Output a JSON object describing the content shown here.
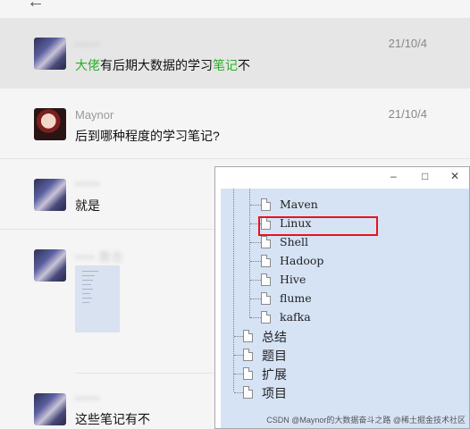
{
  "messages": [
    {
      "name": "•••••",
      "date": "21/10/4",
      "text_parts": [
        "大佬",
        "有后期大数据的学习",
        "笔记",
        "不"
      ]
    },
    {
      "name": "Maynor",
      "date": "21/10/4",
      "text": "后到哪种程度的学习笔记?"
    },
    {
      "name": "•••••",
      "text": "就是"
    },
    {
      "name": "•••• 数仓",
      "text": ""
    },
    {
      "name": "•••••",
      "text": "这些笔记有不"
    }
  ],
  "window": {
    "minimize": "–",
    "maximize": "□",
    "close": "✕"
  },
  "tree": {
    "files": [
      "Maven",
      "Linux",
      "Shell",
      "Hadoop",
      "Hive",
      "flume",
      "kafka"
    ],
    "folders": [
      "总结",
      "题目",
      "扩展",
      "项目"
    ]
  },
  "watermark": "CSDN @Maynor的大数据奋斗之路 @稀土掘金技术社区",
  "colors": {
    "highlight": "#2aae2a",
    "redbox": "#e8131b",
    "tree_bg": "#d6e3f5"
  },
  "icons": {
    "back": "arrow-left-icon",
    "file": "file-icon"
  }
}
